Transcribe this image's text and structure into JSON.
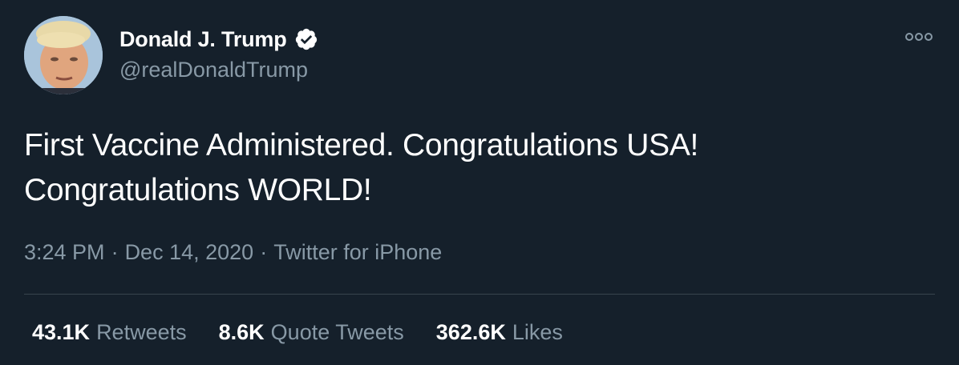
{
  "user": {
    "display_name": "Donald J. Trump",
    "handle": "@realDonaldTrump",
    "verified_icon": "verified-badge-icon",
    "avatar_icon": "avatar"
  },
  "more_icon": "more-options-icon",
  "tweet": {
    "lines": [
      "First Vaccine Administered. Congratulations USA!",
      "Congratulations WORLD!"
    ]
  },
  "meta": {
    "time": "3:24 PM",
    "separator": "·",
    "date": "Dec 14, 2020",
    "source": "Twitter for iPhone"
  },
  "stats": {
    "retweets": {
      "count": "43.1K",
      "label": "Retweets"
    },
    "quotes": {
      "count": "8.6K",
      "label": "Quote Tweets"
    },
    "likes": {
      "count": "362.6K",
      "label": "Likes"
    }
  },
  "colors": {
    "background": "#15202b",
    "primary_text": "#ffffff",
    "secondary_text": "#8899a6",
    "divider": "#38444d"
  }
}
